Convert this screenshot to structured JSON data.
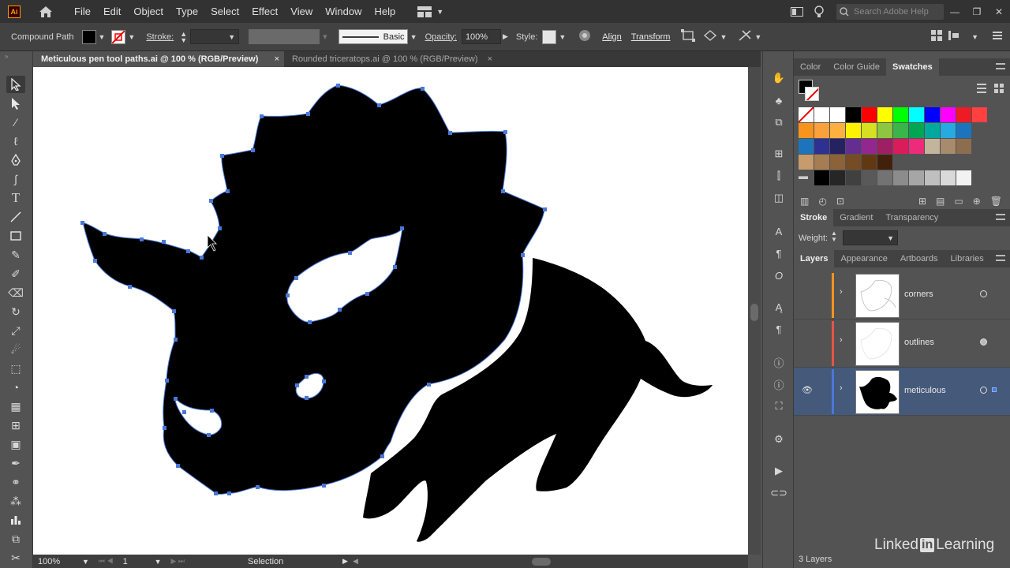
{
  "menubar": {
    "logo": "Ai",
    "items": [
      "File",
      "Edit",
      "Object",
      "Type",
      "Select",
      "Effect",
      "View",
      "Window",
      "Help"
    ],
    "search_placeholder": "Search Adobe Help"
  },
  "control": {
    "selection_type": "Compound Path",
    "stroke_label": "Stroke:",
    "brush_label": "Basic",
    "opacity_label": "Opacity:",
    "opacity_value": "100%",
    "style_label": "Style:",
    "align_label": "Align",
    "transform_label": "Transform"
  },
  "tabs": [
    {
      "label": "Meticulous pen tool paths.ai @ 100 % (RGB/Preview)",
      "close": "×"
    },
    {
      "label": "Rounded triceratops.ai @ 100 % (RGB/Preview)",
      "close": "×"
    }
  ],
  "status": {
    "zoom": "100%",
    "artboard": "1",
    "tool": "Selection"
  },
  "color_panel": {
    "tabs": [
      "Color",
      "Color Guide",
      "Swatches"
    ],
    "swatch_rows": [
      [
        "none",
        "#ffffff",
        "#ffffff",
        "#000000",
        "#ff0000",
        "#ffff00",
        "#00ff00",
        "#00ffff",
        "#0000ff",
        "#ff00ff",
        "#ed1c24",
        "#ff4040"
      ],
      [
        "#f7941d",
        "#f9a13a",
        "#fbb040",
        "#fff200",
        "#d7df23",
        "#8dc63f",
        "#39b54a",
        "#00a651",
        "#00a99d",
        "#27aae1",
        "#1c75bc"
      ],
      [
        "#1c75bc",
        "#2e3192",
        "#262262",
        "#662d91",
        "#92278f",
        "#9e1f63",
        "#da1c5c",
        "#ee2a7b",
        "#c2b59b",
        "#a68b6d",
        "#8c6e4f"
      ],
      [
        "#c69c6d",
        "#a67c52",
        "#8c6239",
        "#754c24",
        "#603913",
        "#42210b"
      ],
      [
        "#000000",
        "#262626",
        "#404040",
        "#595959",
        "#737373",
        "#8c8c8c",
        "#a6a6a6",
        "#bfbfbf",
        "#d9d9d9",
        "#f2f2f2"
      ]
    ]
  },
  "stroke_panel": {
    "tabs": [
      "Stroke",
      "Gradient",
      "Transparency"
    ],
    "weight_label": "Weight:"
  },
  "layers_panel": {
    "tabs": [
      "Layers",
      "Appearance",
      "Artboards",
      "Libraries"
    ],
    "layers": [
      {
        "name": "corners",
        "color": "#f7941d"
      },
      {
        "name": "outlines",
        "color": "#e8544a"
      },
      {
        "name": "meticulous",
        "color": "#4a78d6"
      }
    ],
    "count": "3 Layers"
  },
  "watermark": {
    "part1": "Linked",
    "part2": "in",
    "part3": " Learning"
  }
}
